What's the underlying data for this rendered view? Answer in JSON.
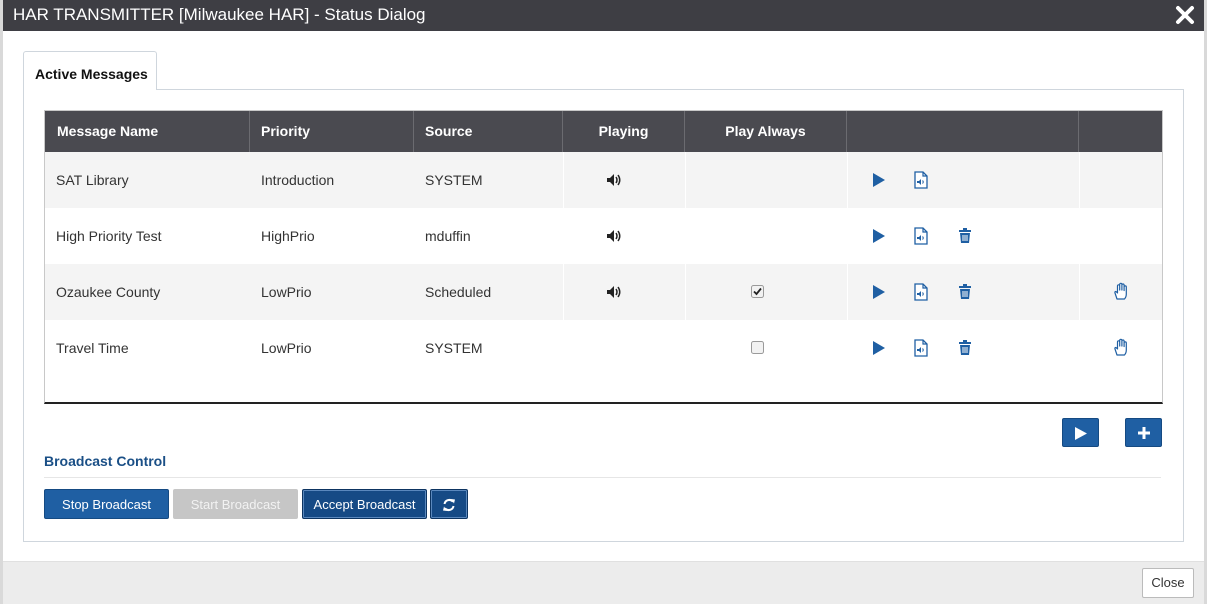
{
  "dialog": {
    "title": "HAR TRANSMITTER [Milwaukee HAR] - Status Dialog",
    "close_icon": "close-x-icon",
    "tab_label": "Active Messages"
  },
  "table": {
    "columns": [
      "Message Name",
      "Priority",
      "Source",
      "Playing",
      "Play Always",
      "",
      ""
    ],
    "rows": [
      {
        "name": "SAT Library",
        "priority": "Introduction",
        "source": "SYSTEM",
        "playing": true,
        "play_always": null,
        "deletable": false,
        "override": false
      },
      {
        "name": "High Priority Test",
        "priority": "HighPrio",
        "source": "mduffin",
        "playing": true,
        "play_always": null,
        "deletable": true,
        "override": false
      },
      {
        "name": "Ozaukee County",
        "priority": "LowPrio",
        "source": "Scheduled",
        "playing": true,
        "play_always": true,
        "deletable": true,
        "override": true
      },
      {
        "name": "Travel Time",
        "priority": "LowPrio",
        "source": "SYSTEM",
        "playing": false,
        "play_always": false,
        "deletable": true,
        "override": true
      }
    ]
  },
  "broadcast": {
    "heading": "Broadcast Control",
    "stop_label": "Stop Broadcast",
    "start_label": "Start Broadcast",
    "accept_label": "Accept Broadcast"
  },
  "footer": {
    "close_label": "Close"
  },
  "colors": {
    "primary": "#1f5fa3",
    "header_bg": "#4a4a50",
    "titlebar_bg": "#3e3e44",
    "icon_blue": "#1f5fa3"
  }
}
